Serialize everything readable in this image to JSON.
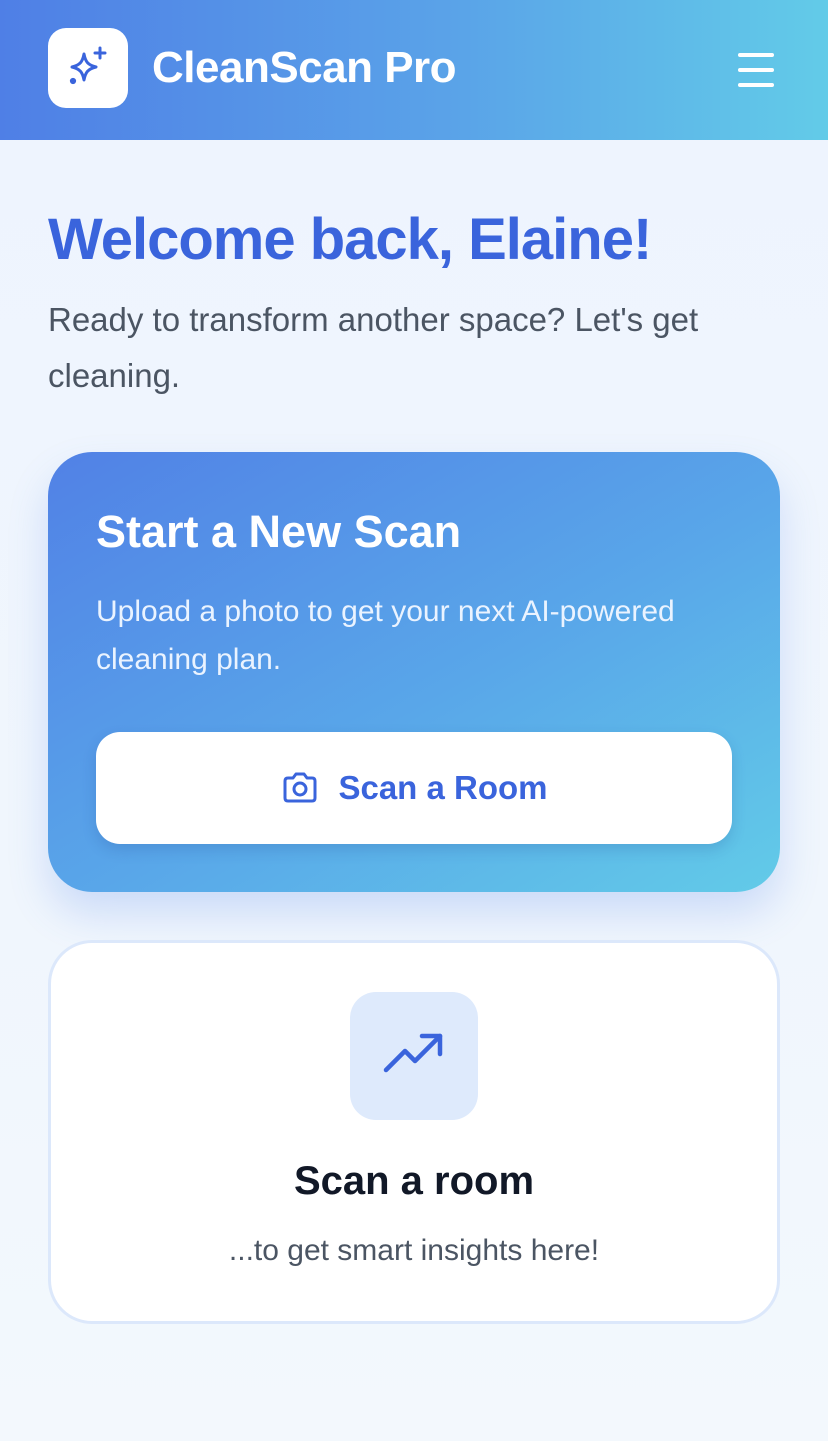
{
  "header": {
    "app_title": "CleanScan Pro",
    "logo_icon": "sparkles-icon",
    "menu_icon": "hamburger-menu-icon"
  },
  "welcome": {
    "title": "Welcome back, Elaine!",
    "subtitle": "Ready to transform another space? Let's get cleaning."
  },
  "scan_card": {
    "title": "Start a New Scan",
    "description": "Upload a photo to get your next AI-powered cleaning plan.",
    "button_label": "Scan a Room",
    "button_icon": "camera-icon"
  },
  "insights_card": {
    "icon": "trending-up-icon",
    "title": "Scan a room",
    "subtitle": "...to get smart insights here!"
  },
  "colors": {
    "accent": "#3a64dc",
    "header_gradient_start": "#4f7fe6",
    "header_gradient_end": "#62cbe8",
    "icon_tile": "#deeafc"
  }
}
